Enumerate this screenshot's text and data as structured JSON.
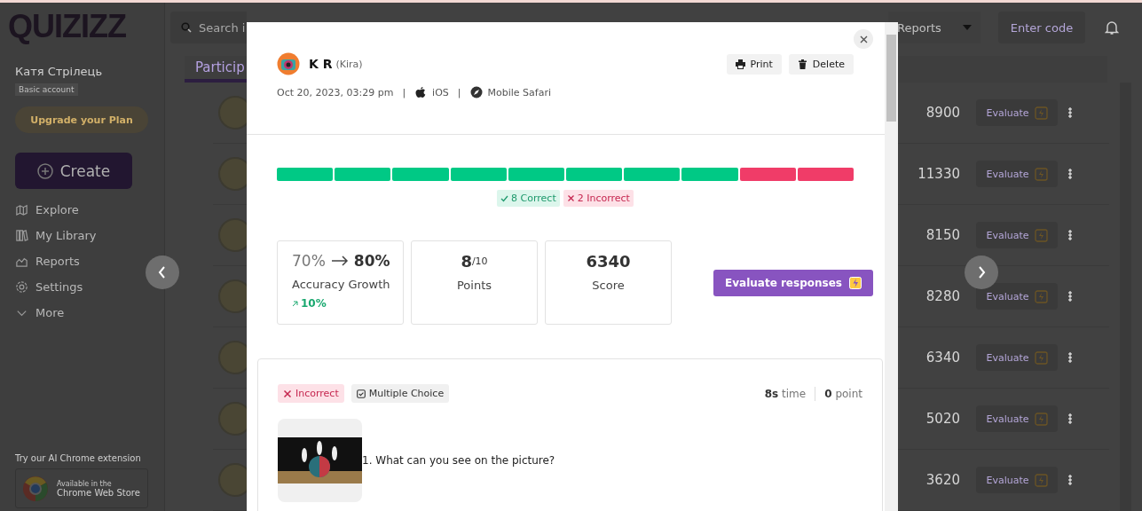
{
  "logo": "QUIZIZZ",
  "sidebar": {
    "user_name": "Катя Стрілець",
    "account_badge": "Basic account",
    "upgrade_button": "Upgrade your Plan",
    "create_button": "Create",
    "nav": [
      {
        "label": "Explore"
      },
      {
        "label": "My Library"
      },
      {
        "label": "Reports"
      },
      {
        "label": "Settings"
      },
      {
        "label": "More"
      }
    ],
    "extension_promo": "Try our AI Chrome extension",
    "store_badge": {
      "line1": "Available in the",
      "line2": "Chrome Web Store"
    }
  },
  "top_bar": {
    "search_placeholder": "Search i",
    "dropdown": "Reports",
    "enter_code_button": "Enter code"
  },
  "tabs": [
    {
      "label": "Particip",
      "selected": true
    }
  ],
  "rows": [
    {
      "score": "8900",
      "action": "Evaluate"
    },
    {
      "score": "11330",
      "action": "Evaluate"
    },
    {
      "score": "8150",
      "action": "Evaluate"
    },
    {
      "score": "8280",
      "action": "Evaluate"
    },
    {
      "score": "6340",
      "action": "Evaluate"
    },
    {
      "score": "5020",
      "action": "Evaluate"
    },
    {
      "score": "3620",
      "action": "Evaluate"
    }
  ],
  "modal": {
    "student": {
      "name": "K R",
      "nickname": "(Kira)"
    },
    "meta": {
      "date": "Oct 20, 2023, 03:29 pm",
      "separator": "|",
      "os": "iOS",
      "browser": "Mobile Safari"
    },
    "actions": [
      "Print",
      "Delete"
    ],
    "answers": [
      {
        "correct": true
      },
      {
        "correct": true
      },
      {
        "correct": true
      },
      {
        "correct": true
      },
      {
        "correct": true
      },
      {
        "correct": true
      },
      {
        "correct": true
      },
      {
        "correct": true
      },
      {
        "correct": false
      },
      {
        "correct": false
      }
    ],
    "correct_badge": "8 Correct",
    "incorrect_badge": "2 Incorrect",
    "accuracy": {
      "from": "70%",
      "to": "80%",
      "label": "Accuracy Growth",
      "delta": "10%"
    },
    "points": {
      "value": "8",
      "total": "/10",
      "label": "Points"
    },
    "score": {
      "value": "6340",
      "label": "Score"
    },
    "evaluate_button": "Evaluate responses",
    "question": {
      "correct": false,
      "status": "Incorrect",
      "type": "Multiple Choice",
      "time": "8s",
      "time_label": "time",
      "points": "0",
      "points_label": "point",
      "text": "1. What can you see on the picture?"
    }
  }
}
